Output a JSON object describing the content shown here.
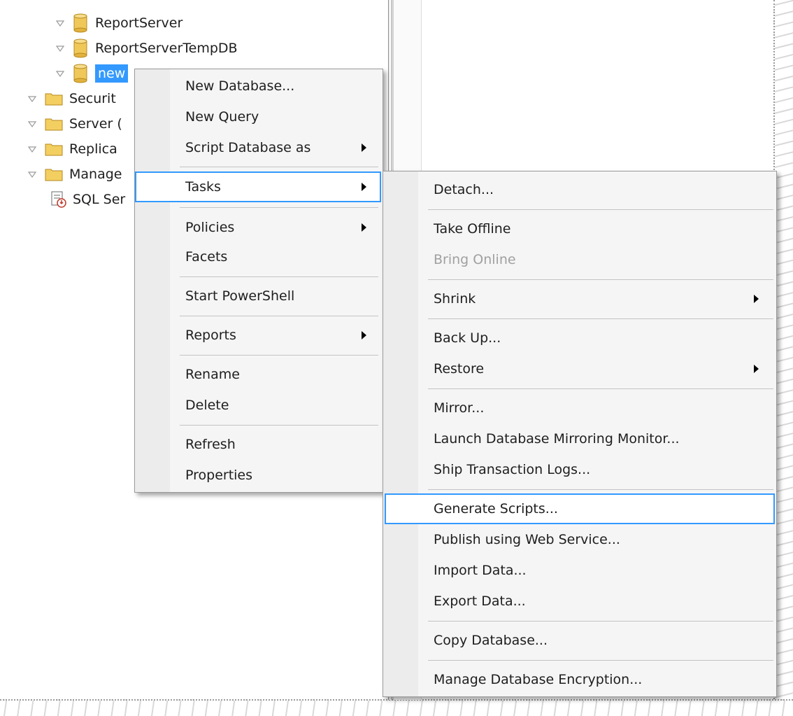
{
  "tree": {
    "items": [
      {
        "label": "ReportServer",
        "icon": "database-icon"
      },
      {
        "label": "ReportServerTempDB",
        "icon": "database-icon"
      },
      {
        "label": "new",
        "icon": "database-icon",
        "selected": true
      },
      {
        "label": "Securit",
        "icon": "folder-icon"
      },
      {
        "label": "Server (",
        "icon": "folder-icon"
      },
      {
        "label": "Replica",
        "icon": "folder-icon"
      },
      {
        "label": "Manage",
        "icon": "folder-icon"
      },
      {
        "label": "SQL Ser",
        "icon": "log-icon"
      }
    ]
  },
  "context_menu": {
    "items": [
      {
        "label": "New Database..."
      },
      {
        "label": "New Query"
      },
      {
        "label": "Script Database as",
        "submenu": true
      },
      {
        "label": "Tasks",
        "submenu": true,
        "highlighted": true
      },
      {
        "label": "Policies",
        "submenu": true
      },
      {
        "label": "Facets"
      },
      {
        "label": "Start PowerShell"
      },
      {
        "label": "Reports",
        "submenu": true
      },
      {
        "label": "Rename"
      },
      {
        "label": "Delete"
      },
      {
        "label": "Refresh"
      },
      {
        "label": "Properties"
      }
    ]
  },
  "tasks_submenu": {
    "items": [
      {
        "label": "Detach..."
      },
      {
        "label": "Take Offline"
      },
      {
        "label": "Bring Online",
        "disabled": true
      },
      {
        "label": "Shrink",
        "submenu": true
      },
      {
        "label": "Back Up..."
      },
      {
        "label": "Restore",
        "submenu": true
      },
      {
        "label": "Mirror..."
      },
      {
        "label": "Launch Database Mirroring Monitor..."
      },
      {
        "label": "Ship Transaction Logs..."
      },
      {
        "label": "Generate Scripts...",
        "highlighted": true
      },
      {
        "label": "Publish using Web Service..."
      },
      {
        "label": "Import Data..."
      },
      {
        "label": "Export Data..."
      },
      {
        "label": "Copy Database..."
      },
      {
        "label": "Manage Database Encryption..."
      }
    ]
  },
  "colors": {
    "selection": "#3399ff",
    "menu_background": "#f5f5f5",
    "disabled_text": "#a0a0a0"
  }
}
